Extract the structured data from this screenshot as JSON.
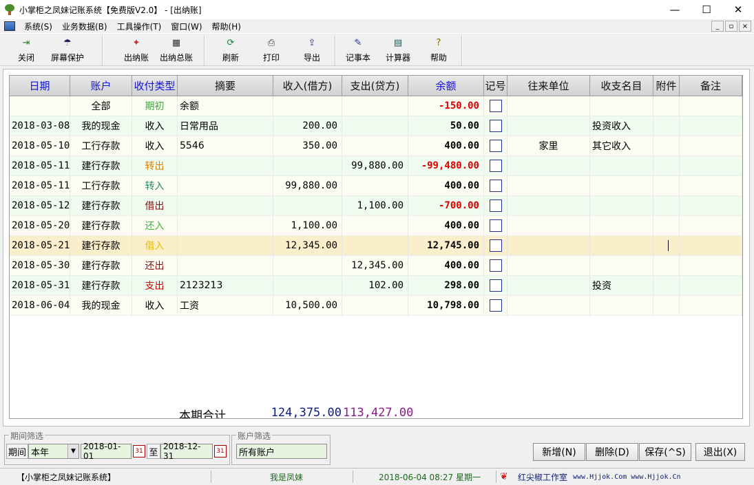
{
  "window": {
    "title": "小掌柜之凤妹记账系统【免费版V2.0】 - [出纳账]",
    "minimize": "—",
    "maximize": "☐",
    "close": "✕"
  },
  "menu": {
    "items": [
      "系统(S)",
      "业务数据(B)",
      "工具操作(T)",
      "窗口(W)",
      "帮助(H)"
    ],
    "mdi": [
      "_",
      "▫",
      "×"
    ]
  },
  "toolbar": {
    "buttons": [
      {
        "label": "关闭",
        "icon": "exit-door-icon",
        "glyph": "⇥",
        "color": "#2a7a2a"
      },
      {
        "label": "屏幕保护",
        "icon": "umbrella-icon",
        "glyph": "☂",
        "color": "#202060"
      },
      {
        "label": "出纳账",
        "icon": "cash-book-icon",
        "glyph": "✦",
        "color": "#c03030"
      },
      {
        "label": "出纳总账",
        "icon": "ledger-grid-icon",
        "glyph": "▦",
        "color": "#303030"
      },
      {
        "label": "刷新",
        "icon": "refresh-icon",
        "glyph": "⟳",
        "color": "#1a7a3a"
      },
      {
        "label": "打印",
        "icon": "printer-icon",
        "glyph": "⎙",
        "color": "#303030"
      },
      {
        "label": "导出",
        "icon": "export-icon",
        "glyph": "⇪",
        "color": "#2a3a8a"
      },
      {
        "label": "记事本",
        "icon": "notepad-icon",
        "glyph": "✎",
        "color": "#2a2a9a"
      },
      {
        "label": "计算器",
        "icon": "calculator-icon",
        "glyph": "▤",
        "color": "#1a5a5a"
      },
      {
        "label": "帮助",
        "icon": "help-icon",
        "glyph": "?",
        "color": "#7a6a00"
      }
    ]
  },
  "grid": {
    "columns": [
      "日期",
      "账户",
      "收付类型",
      "摘要",
      "收入(借方)",
      "支出(贷方)",
      "余额",
      "记号",
      "往来单位",
      "收支名目",
      "附件",
      "备注"
    ],
    "rows": [
      {
        "date": "",
        "account": "全部",
        "type": "期初",
        "typeColor": "#3aa83a",
        "summary": "余额",
        "income": "",
        "expense": "",
        "balance": "-150.00",
        "balColor": "#e00000",
        "party": "",
        "category": ""
      },
      {
        "date": "2018-03-08",
        "account": "我的现金",
        "type": "收入",
        "typeColor": "#000000",
        "summary": "日常用品",
        "income": "200.00",
        "expense": "",
        "balance": "50.00",
        "balColor": "#000000",
        "party": "",
        "category": "投资收入"
      },
      {
        "date": "2018-05-10",
        "account": "工行存款",
        "type": "收入",
        "typeColor": "#000000",
        "summary": "5546",
        "income": "350.00",
        "expense": "",
        "balance": "400.00",
        "balColor": "#000000",
        "party": "家里",
        "category": "其它收入"
      },
      {
        "date": "2018-05-11",
        "account": "建行存款",
        "type": "转出",
        "typeColor": "#e08000",
        "summary": "",
        "income": "",
        "expense": "99,880.00",
        "balance": "-99,480.00",
        "balColor": "#e00000",
        "party": "",
        "category": ""
      },
      {
        "date": "2018-05-11",
        "account": "工行存款",
        "type": "转入",
        "typeColor": "#2a8a6a",
        "summary": "",
        "income": "99,880.00",
        "expense": "",
        "balance": "400.00",
        "balColor": "#000000",
        "party": "",
        "category": ""
      },
      {
        "date": "2018-05-12",
        "account": "建行存款",
        "type": "借出",
        "typeColor": "#8a1010",
        "summary": "",
        "income": "",
        "expense": "1,100.00",
        "balance": "-700.00",
        "balColor": "#e00000",
        "party": "",
        "category": ""
      },
      {
        "date": "2018-05-20",
        "account": "建行存款",
        "type": "还入",
        "typeColor": "#40b040",
        "summary": "",
        "income": "1,100.00",
        "expense": "",
        "balance": "400.00",
        "balColor": "#000000",
        "party": "",
        "category": ""
      },
      {
        "date": "2018-05-21",
        "account": "建行存款",
        "type": "借入",
        "typeColor": "#e8c000",
        "summary": "",
        "income": "12,345.00",
        "expense": "",
        "balance": "12,745.00",
        "balColor": "#000000",
        "party": "",
        "category": ""
      },
      {
        "date": "2018-05-30",
        "account": "建行存款",
        "type": "还出",
        "typeColor": "#8a1010",
        "summary": "",
        "income": "",
        "expense": "12,345.00",
        "balance": "400.00",
        "balColor": "#000000",
        "party": "",
        "category": ""
      },
      {
        "date": "2018-05-31",
        "account": "建行存款",
        "type": "支出",
        "typeColor": "#c00000",
        "summary": "2123213",
        "income": "",
        "expense": "102.00",
        "balance": "298.00",
        "balColor": "#000000",
        "party": "",
        "category": "投资"
      },
      {
        "date": "2018-06-04",
        "account": "我的现金",
        "type": "收入",
        "typeColor": "#000000",
        "summary": "工资",
        "income": "10,500.00",
        "expense": "",
        "balance": "10,798.00",
        "balColor": "#000000",
        "party": "",
        "category": ""
      }
    ],
    "selected_row": 7,
    "totals": {
      "label": "本期合计",
      "income": "124,375.00",
      "expense": "113,427.00"
    }
  },
  "filters": {
    "period_group": "期间筛选",
    "period_label": "期间",
    "period_value": "本年",
    "date_from": "2018-01-01",
    "to_label": "至",
    "date_to": "2018-12-31",
    "cal_glyph": "31",
    "account_group": "账户筛选",
    "account_value": "所有账户"
  },
  "actions": {
    "add": "新增(N)",
    "delete": "删除(D)",
    "save": "保存(^S)",
    "exit": "退出(X)"
  },
  "status": {
    "app": "【小掌柜之凤妹记账系统】",
    "user": "我是凤妹",
    "datetime": "2018-06-04 08:27 星期一",
    "studio": "红尖椒工作室",
    "urls": "www.Hjjok.Com www.Hjjok.Cn"
  },
  "colors": {
    "header_blue": "#1010d8",
    "row_stripe": "#eefbee",
    "row_plain": "#fcfcf3",
    "row_selected": "#fbeecb"
  }
}
